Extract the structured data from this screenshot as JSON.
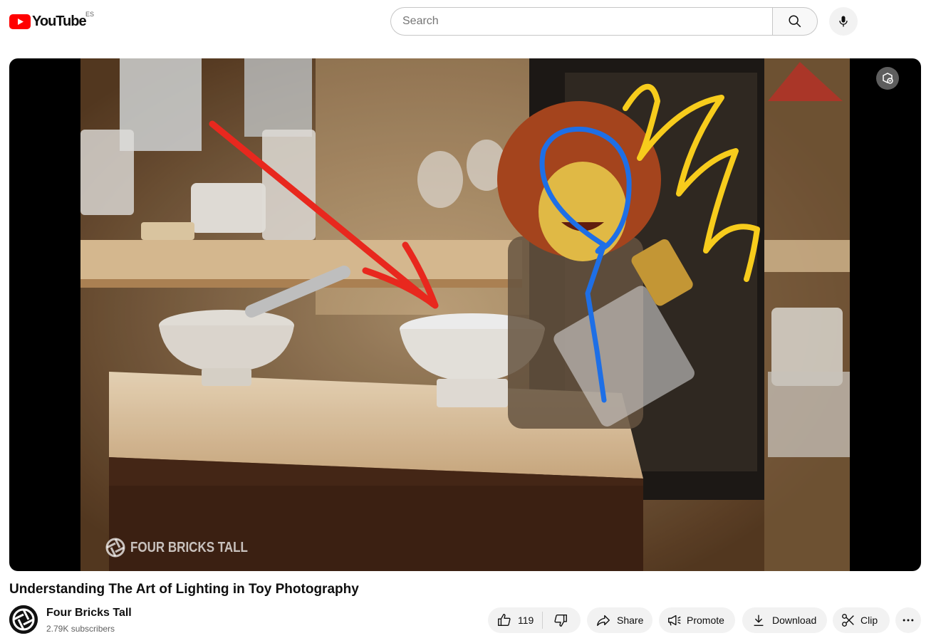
{
  "masthead": {
    "logo_text": "YouTube",
    "country_code": "ES",
    "brand_color": "#ff0000",
    "search_placeholder": "Search"
  },
  "player": {
    "watermark": "FOUR BRICKS TALL",
    "ambient_icon": "ambient-mode-icon"
  },
  "video": {
    "title": "Understanding The Art of Lighting in Toy Photography",
    "channel_name": "Four Bricks Tall",
    "subscribers": "2.79K subscribers"
  },
  "actions": {
    "like_count": "119",
    "share_label": "Share",
    "promote_label": "Promote",
    "download_label": "Download",
    "clip_label": "Clip"
  },
  "icons": [
    "youtube-logo-icon",
    "search-icon",
    "mic-icon",
    "like-icon",
    "dislike-icon",
    "share-icon",
    "promote-icon",
    "download-icon",
    "clip-icon",
    "more-icon"
  ],
  "colors": {
    "annotation_red": "#e8281e",
    "annotation_blue": "#1e6fe6",
    "annotation_yellow": "#f7cc1c"
  }
}
